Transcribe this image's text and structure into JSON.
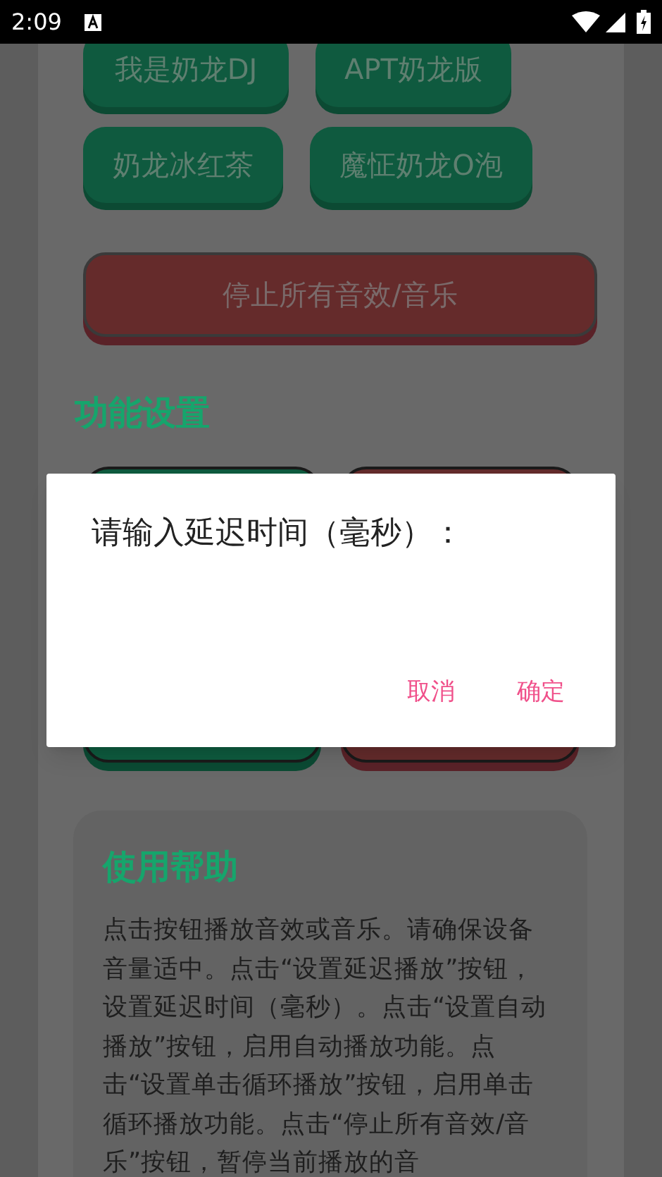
{
  "status_bar": {
    "time": "2:09"
  },
  "sound_buttons": [
    [
      {
        "label": "我是奶龙DJ"
      },
      {
        "label": "APT奶龙版"
      }
    ],
    [
      {
        "label": "奶龙冰红茶"
      },
      {
        "label": "魔怔奶龙O泡"
      }
    ]
  ],
  "stop_button": {
    "label": "停止所有音效/音乐"
  },
  "settings": {
    "title": "功能设置",
    "buttons": [
      {
        "kind": "primary"
      },
      {
        "kind": "danger"
      }
    ]
  },
  "help": {
    "title": "使用帮助",
    "text": "点击按钮播放音效或音乐。请确保设备音量适中。点击“设置延迟播放”按钮，设置延迟时间（毫秒）。点击“设置自动播放”按钮，启用自动播放功能。点击“设置单击循环播放”按钮，启用单击循环播放功能。点击“停止所有音效/音乐”按钮，暂停当前播放的音"
  },
  "dialog": {
    "title": "请输入延迟时间（毫秒）：",
    "buttons": [
      "取消",
      "确定"
    ]
  }
}
